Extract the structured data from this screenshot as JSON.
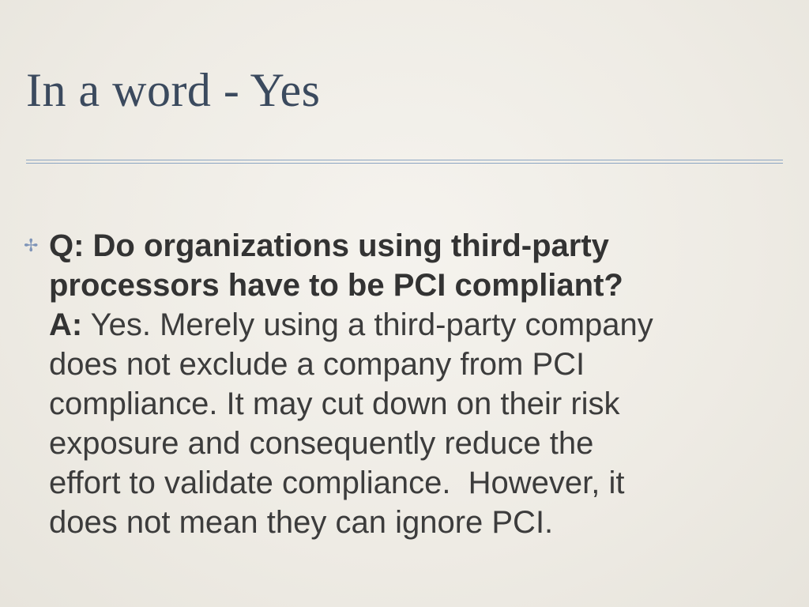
{
  "slide": {
    "title": "In a word - Yes",
    "bullet_glyph": "✢",
    "question_lines": [
      "Q: Do organizations using third-party",
      "processors have to be PCI compliant?"
    ],
    "answer_label": "A:",
    "answer_lines": [
      " Yes. Merely using a third-party company",
      "does not exclude a company from PCI",
      "compliance. It may cut down on their risk",
      "exposure and consequently reduce the",
      "effort to validate compliance.  However, it",
      "does not mean they can ignore PCI."
    ]
  },
  "colors": {
    "background": "#efede7",
    "title": "#3b4a5e",
    "rule": "#8da6c3",
    "body_text": "#3c3c3c",
    "bullet": "#7e94b8"
  }
}
